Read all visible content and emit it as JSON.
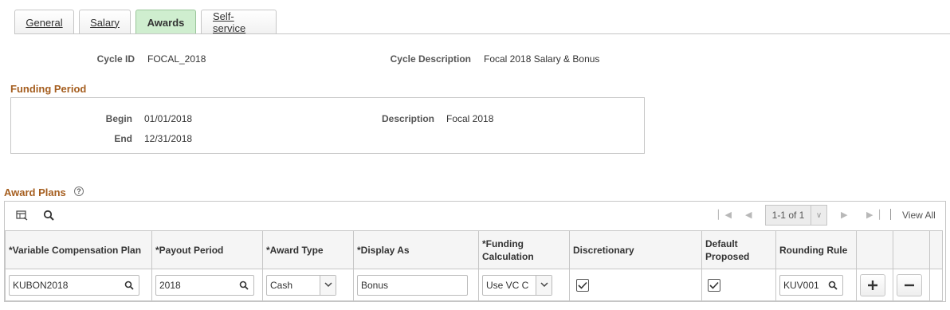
{
  "tabs": [
    {
      "label": "General"
    },
    {
      "label": "Salary"
    },
    {
      "label": "Awards"
    },
    {
      "label": "Self-service"
    }
  ],
  "cycle": {
    "id_label": "Cycle ID",
    "id_value": "FOCAL_2018",
    "desc_label": "Cycle Description",
    "desc_value": "Focal 2018 Salary & Bonus"
  },
  "funding": {
    "title": "Funding Period",
    "begin_label": "Begin",
    "begin_value": "01/01/2018",
    "end_label": "End",
    "end_value": "12/31/2018",
    "desc_label": "Description",
    "desc_value": "Focal 2018"
  },
  "award_plans": {
    "title": "Award Plans",
    "pager_text": "1-1 of 1",
    "view_all": "View All",
    "columns": [
      "*Variable Compensation Plan",
      "*Payout Period",
      "*Award Type",
      "*Display As",
      "*Funding Calculation",
      "Discretionary",
      "Default Proposed",
      "Rounding Rule"
    ],
    "row": {
      "vc_plan": "KUBON2018",
      "payout_period": "2018",
      "award_type": "Cash",
      "display_as": "Bonus",
      "funding_calc": "Use VC C",
      "discretionary": true,
      "default_proposed": true,
      "rounding_rule": "KUV001"
    }
  }
}
